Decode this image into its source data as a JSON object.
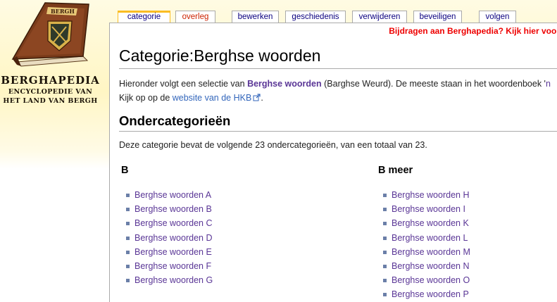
{
  "logo": {
    "book_label": "BERGH",
    "title": "BERGHAPEDIA",
    "subtitle_line1": "ENCYCLOPEDIE VAN",
    "subtitle_line2": "HET LAND VAN BERGH"
  },
  "tabs": [
    {
      "label": "categorie",
      "selected": true
    },
    {
      "label": "overleg",
      "new": true
    },
    {
      "label": "bewerken"
    },
    {
      "label": "geschiedenis"
    },
    {
      "label": "verwijderen"
    },
    {
      "label": "beveiligen"
    },
    {
      "label": "volgen"
    }
  ],
  "sitenotice": "Bijdragen aan Berghapedia? Kijk hier voor",
  "page_title": "Categorie:Berghse woorden",
  "intro": {
    "text1": "Hieronder volgt een selectie van ",
    "bold_link": "Berghse woorden",
    "text2": " (Barghse Weurd). De meeste staan in het woordenboek '",
    "trail": "n",
    "line2_text": "Kijk op op de ",
    "ext_link": "website van de HKB",
    "line2_end": "."
  },
  "section_title": "Ondercategorieën",
  "count_text": "Deze categorie bevat de volgende 23 ondercategorieën, van een totaal van 23.",
  "columns": [
    {
      "heading": "B",
      "items": [
        "Berghse woorden A",
        "Berghse woorden B",
        "Berghse woorden C",
        "Berghse woorden D",
        "Berghse woorden E",
        "Berghse woorden F",
        "Berghse woorden G"
      ]
    },
    {
      "heading": "B meer",
      "items": [
        "Berghse woorden H",
        "Berghse woorden I",
        "Berghse woorden K",
        "Berghse woorden L",
        "Berghse woorden M",
        "Berghse woorden N",
        "Berghse woorden O",
        "Berghse woorden P"
      ]
    }
  ],
  "colors": {
    "tab_selected_border": "#fabd23",
    "link": "#3366bb",
    "visited_link": "#5a3696",
    "new_link": "#cc2200",
    "notice": "#ee0000"
  }
}
